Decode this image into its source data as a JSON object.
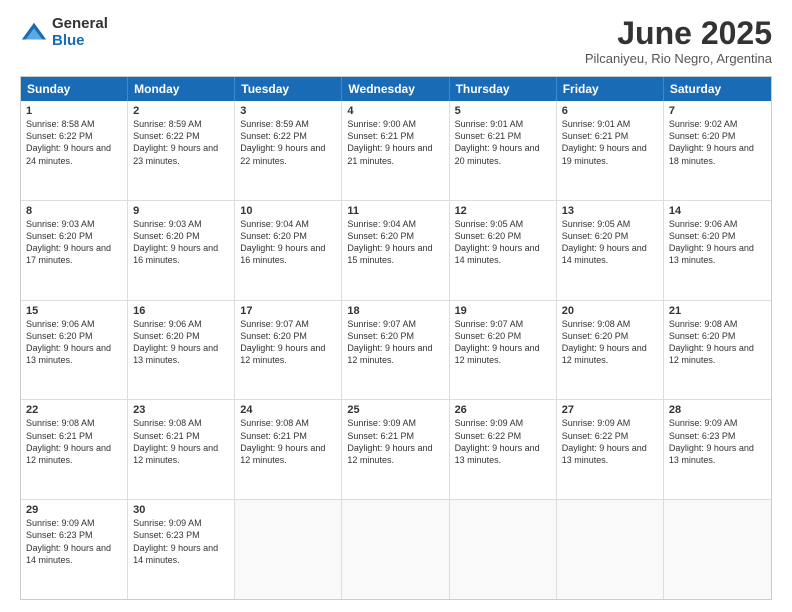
{
  "logo": {
    "general": "General",
    "blue": "Blue"
  },
  "title": "June 2025",
  "location": "Pilcaniyeu, Rio Negro, Argentina",
  "header_days": [
    "Sunday",
    "Monday",
    "Tuesday",
    "Wednesday",
    "Thursday",
    "Friday",
    "Saturday"
  ],
  "weeks": [
    [
      {
        "day": "1",
        "sunrise": "Sunrise: 8:58 AM",
        "sunset": "Sunset: 6:22 PM",
        "daylight": "Daylight: 9 hours and 24 minutes."
      },
      {
        "day": "2",
        "sunrise": "Sunrise: 8:59 AM",
        "sunset": "Sunset: 6:22 PM",
        "daylight": "Daylight: 9 hours and 23 minutes."
      },
      {
        "day": "3",
        "sunrise": "Sunrise: 8:59 AM",
        "sunset": "Sunset: 6:22 PM",
        "daylight": "Daylight: 9 hours and 22 minutes."
      },
      {
        "day": "4",
        "sunrise": "Sunrise: 9:00 AM",
        "sunset": "Sunset: 6:21 PM",
        "daylight": "Daylight: 9 hours and 21 minutes."
      },
      {
        "day": "5",
        "sunrise": "Sunrise: 9:01 AM",
        "sunset": "Sunset: 6:21 PM",
        "daylight": "Daylight: 9 hours and 20 minutes."
      },
      {
        "day": "6",
        "sunrise": "Sunrise: 9:01 AM",
        "sunset": "Sunset: 6:21 PM",
        "daylight": "Daylight: 9 hours and 19 minutes."
      },
      {
        "day": "7",
        "sunrise": "Sunrise: 9:02 AM",
        "sunset": "Sunset: 6:20 PM",
        "daylight": "Daylight: 9 hours and 18 minutes."
      }
    ],
    [
      {
        "day": "8",
        "sunrise": "Sunrise: 9:03 AM",
        "sunset": "Sunset: 6:20 PM",
        "daylight": "Daylight: 9 hours and 17 minutes."
      },
      {
        "day": "9",
        "sunrise": "Sunrise: 9:03 AM",
        "sunset": "Sunset: 6:20 PM",
        "daylight": "Daylight: 9 hours and 16 minutes."
      },
      {
        "day": "10",
        "sunrise": "Sunrise: 9:04 AM",
        "sunset": "Sunset: 6:20 PM",
        "daylight": "Daylight: 9 hours and 16 minutes."
      },
      {
        "day": "11",
        "sunrise": "Sunrise: 9:04 AM",
        "sunset": "Sunset: 6:20 PM",
        "daylight": "Daylight: 9 hours and 15 minutes."
      },
      {
        "day": "12",
        "sunrise": "Sunrise: 9:05 AM",
        "sunset": "Sunset: 6:20 PM",
        "daylight": "Daylight: 9 hours and 14 minutes."
      },
      {
        "day": "13",
        "sunrise": "Sunrise: 9:05 AM",
        "sunset": "Sunset: 6:20 PM",
        "daylight": "Daylight: 9 hours and 14 minutes."
      },
      {
        "day": "14",
        "sunrise": "Sunrise: 9:06 AM",
        "sunset": "Sunset: 6:20 PM",
        "daylight": "Daylight: 9 hours and 13 minutes."
      }
    ],
    [
      {
        "day": "15",
        "sunrise": "Sunrise: 9:06 AM",
        "sunset": "Sunset: 6:20 PM",
        "daylight": "Daylight: 9 hours and 13 minutes."
      },
      {
        "day": "16",
        "sunrise": "Sunrise: 9:06 AM",
        "sunset": "Sunset: 6:20 PM",
        "daylight": "Daylight: 9 hours and 13 minutes."
      },
      {
        "day": "17",
        "sunrise": "Sunrise: 9:07 AM",
        "sunset": "Sunset: 6:20 PM",
        "daylight": "Daylight: 9 hours and 12 minutes."
      },
      {
        "day": "18",
        "sunrise": "Sunrise: 9:07 AM",
        "sunset": "Sunset: 6:20 PM",
        "daylight": "Daylight: 9 hours and 12 minutes."
      },
      {
        "day": "19",
        "sunrise": "Sunrise: 9:07 AM",
        "sunset": "Sunset: 6:20 PM",
        "daylight": "Daylight: 9 hours and 12 minutes."
      },
      {
        "day": "20",
        "sunrise": "Sunrise: 9:08 AM",
        "sunset": "Sunset: 6:20 PM",
        "daylight": "Daylight: 9 hours and 12 minutes."
      },
      {
        "day": "21",
        "sunrise": "Sunrise: 9:08 AM",
        "sunset": "Sunset: 6:20 PM",
        "daylight": "Daylight: 9 hours and 12 minutes."
      }
    ],
    [
      {
        "day": "22",
        "sunrise": "Sunrise: 9:08 AM",
        "sunset": "Sunset: 6:21 PM",
        "daylight": "Daylight: 9 hours and 12 minutes."
      },
      {
        "day": "23",
        "sunrise": "Sunrise: 9:08 AM",
        "sunset": "Sunset: 6:21 PM",
        "daylight": "Daylight: 9 hours and 12 minutes."
      },
      {
        "day": "24",
        "sunrise": "Sunrise: 9:08 AM",
        "sunset": "Sunset: 6:21 PM",
        "daylight": "Daylight: 9 hours and 12 minutes."
      },
      {
        "day": "25",
        "sunrise": "Sunrise: 9:09 AM",
        "sunset": "Sunset: 6:21 PM",
        "daylight": "Daylight: 9 hours and 12 minutes."
      },
      {
        "day": "26",
        "sunrise": "Sunrise: 9:09 AM",
        "sunset": "Sunset: 6:22 PM",
        "daylight": "Daylight: 9 hours and 13 minutes."
      },
      {
        "day": "27",
        "sunrise": "Sunrise: 9:09 AM",
        "sunset": "Sunset: 6:22 PM",
        "daylight": "Daylight: 9 hours and 13 minutes."
      },
      {
        "day": "28",
        "sunrise": "Sunrise: 9:09 AM",
        "sunset": "Sunset: 6:23 PM",
        "daylight": "Daylight: 9 hours and 13 minutes."
      }
    ],
    [
      {
        "day": "29",
        "sunrise": "Sunrise: 9:09 AM",
        "sunset": "Sunset: 6:23 PM",
        "daylight": "Daylight: 9 hours and 14 minutes."
      },
      {
        "day": "30",
        "sunrise": "Sunrise: 9:09 AM",
        "sunset": "Sunset: 6:23 PM",
        "daylight": "Daylight: 9 hours and 14 minutes."
      },
      null,
      null,
      null,
      null,
      null
    ]
  ]
}
